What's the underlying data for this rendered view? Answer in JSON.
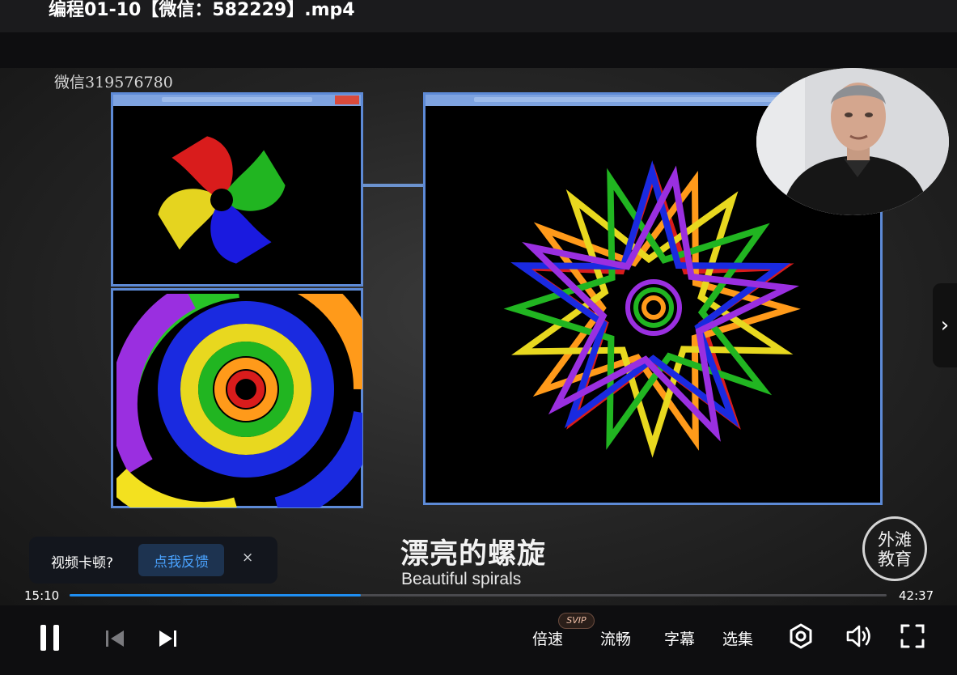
{
  "window": {
    "title": "编程01-10【微信：582229】.mp4"
  },
  "video": {
    "watermark": "微信319576780",
    "subtitle_cn": "漂亮的螺旋",
    "subtitle_en": "Beautiful spirals",
    "logo_line1": "外滩",
    "logo_line2": "教育"
  },
  "feedback_toast": {
    "label": "视频卡顿?",
    "action": "点我反馈",
    "close": "×"
  },
  "player": {
    "current_time": "15:10",
    "total_time": "42:37",
    "progress_fraction": 0.356,
    "speed_label": "倍速",
    "speed_badge": "SVIP",
    "quality_label": "流畅",
    "subtitles_label": "字幕",
    "episodes_label": "选集",
    "accent_color": "#1f8ef1"
  },
  "icons": [
    "pause-icon",
    "previous-icon",
    "next-icon",
    "settings-icon",
    "volume-icon",
    "fullscreen-icon",
    "chevron-right-icon",
    "close-icon"
  ]
}
